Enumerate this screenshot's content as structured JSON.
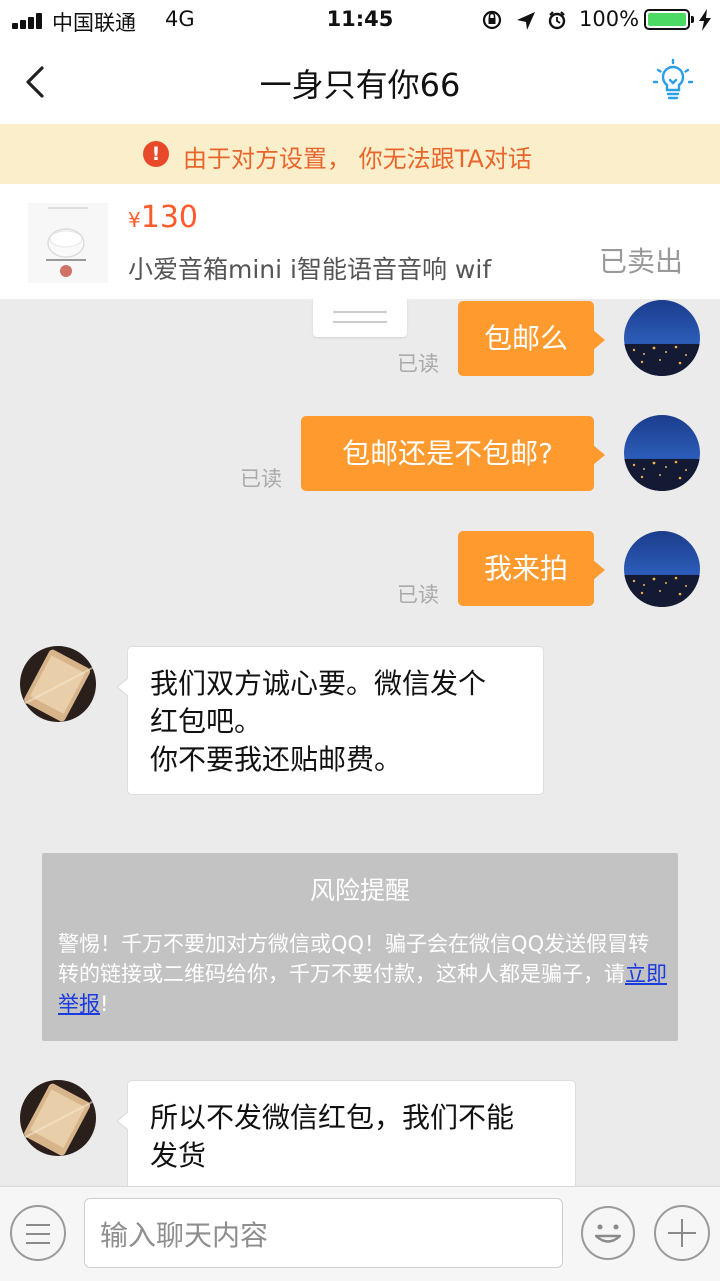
{
  "status_bar": {
    "carrier": "中国联通",
    "network": "4G",
    "time": "11:45",
    "battery_percent": "100%",
    "battery_level": 1.0,
    "battery_color": "#4cd964"
  },
  "nav": {
    "title": "一身只有你66",
    "back_icon": "chevron-left-icon",
    "right_icon": "lightbulb-icon"
  },
  "warning": {
    "icon": "exclamation-circle-icon",
    "text": "由于对方设置， 你无法跟TA对话"
  },
  "product": {
    "currency_symbol": "¥",
    "price": "130",
    "name": "小爱音箱mini i智能语音音响 wif",
    "status": "已卖出"
  },
  "messages": [
    {
      "side": "out",
      "text": "包邮么",
      "read": "已读"
    },
    {
      "side": "out",
      "text": "包邮还是不包邮?",
      "read": "已读"
    },
    {
      "side": "out",
      "text": "我来拍",
      "read": "已读"
    },
    {
      "side": "in",
      "lines": [
        "我们双方诚心要。微信发个",
        "红包吧。",
        "你不要我还贴邮费。"
      ]
    },
    {
      "side": "in",
      "lines": [
        "所以不发微信红包，我们不能",
        "发货"
      ]
    }
  ],
  "risk_notice": {
    "title": "风险提醒",
    "body_before_link": "警惕！千万不要加对方微信或QQ！骗子会在微信QQ发送假冒转转的链接或二维码给你，千万不要付款，这种人都是骗子，请",
    "link_text": "立即举报",
    "body_after_link": "!"
  },
  "input_bar": {
    "placeholder": "输入聊天内容",
    "left_icon": "menu-icon",
    "emoji_icon": "emoji-icon",
    "plus_icon": "plus-icon"
  },
  "colors": {
    "accent_orange": "#ff9a2e",
    "price_red": "#ff5a2c",
    "warning_bg": "#fbefcb",
    "warning_text": "#e8662c",
    "link_blue": "#1a3be0"
  }
}
